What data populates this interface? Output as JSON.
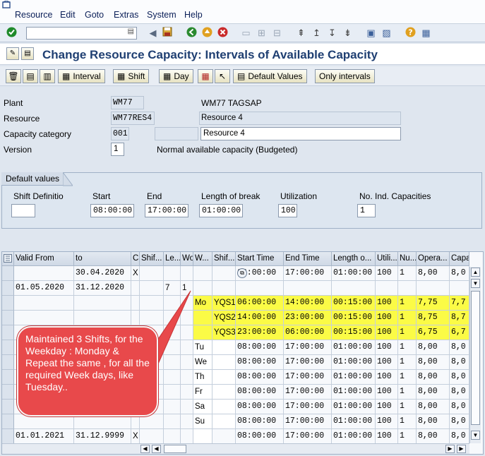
{
  "menu": {
    "items": [
      "Resource",
      "Edit",
      "Goto",
      "Extras",
      "System",
      "Help"
    ]
  },
  "title": "Change Resource Capacity: Intervals of Available Capacity",
  "toolbar": {
    "buttons": {
      "interval": "Interval",
      "shift": "Shift",
      "day": "Day",
      "default_values": "Default Values",
      "only_intervals": "Only intervals"
    }
  },
  "header": {
    "plant_label": "Plant",
    "plant_value": "WM77",
    "plant_desc": "WM77 TAGSAP",
    "resource_label": "Resource",
    "resource_value": "WM77RES4",
    "resource_desc": "Resource 4",
    "capcat_label": "Capacity category",
    "capcat_value": "001",
    "capcat_desc": "Resource 4",
    "version_label": "Version",
    "version_value": "1",
    "version_desc": "Normal available capacity (Budgeted)"
  },
  "defaults": {
    "group_title": "Default values",
    "shift_def_label": "Shift Definitio",
    "shift_def_value": "",
    "start_label": "Start",
    "start_value": "08:00:00",
    "end_label": "End",
    "end_value": "17:00:00",
    "break_label": "Length of break",
    "break_value": "01:00:00",
    "util_label": "Utilization",
    "util_value": "100",
    "indcap_label": "No. Ind. Capacities",
    "indcap_value": "1"
  },
  "table": {
    "columns": [
      "Valid From",
      "to",
      "C",
      "Shif...",
      "Le...",
      "Wo",
      "W...",
      "Shif...",
      "Start Time",
      "End Time",
      "Length o...",
      "Utili...",
      "Nu...",
      "Opera...",
      "Capa"
    ],
    "rows": [
      [
        "",
        "30.04.2020",
        "X",
        "",
        "",
        "",
        "",
        "",
        "08:00:00",
        "17:00:00",
        "01:00:00",
        "100",
        "1",
        "8,00",
        "8,0"
      ],
      [
        "01.05.2020",
        "31.12.2020",
        "",
        "",
        "7",
        "1",
        "",
        "",
        "",
        "",
        "",
        "",
        "",
        "",
        ""
      ],
      [
        "",
        "",
        "",
        "",
        "",
        "",
        "Mo",
        "YQS1",
        "06:00:00",
        "14:00:00",
        "00:15:00",
        "100",
        "1",
        "7,75",
        "7,7"
      ],
      [
        "",
        "",
        "",
        "",
        "",
        "",
        "",
        "YQS2",
        "14:00:00",
        "23:00:00",
        "00:15:00",
        "100",
        "1",
        "8,75",
        "8,7"
      ],
      [
        "",
        "",
        "",
        "",
        "",
        "",
        "",
        "YQS3",
        "23:00:00",
        "06:00:00",
        "00:15:00",
        "100",
        "1",
        "6,75",
        "6,7"
      ],
      [
        "",
        "",
        "",
        "",
        "",
        "",
        "Tu",
        "",
        "08:00:00",
        "17:00:00",
        "01:00:00",
        "100",
        "1",
        "8,00",
        "8,0"
      ],
      [
        "",
        "",
        "",
        "",
        "",
        "",
        "We",
        "",
        "08:00:00",
        "17:00:00",
        "01:00:00",
        "100",
        "1",
        "8,00",
        "8,0"
      ],
      [
        "",
        "",
        "",
        "",
        "",
        "",
        "Th",
        "",
        "08:00:00",
        "17:00:00",
        "01:00:00",
        "100",
        "1",
        "8,00",
        "8,0"
      ],
      [
        "",
        "",
        "",
        "",
        "",
        "",
        "Fr",
        "",
        "08:00:00",
        "17:00:00",
        "01:00:00",
        "100",
        "1",
        "8,00",
        "8,0"
      ],
      [
        "",
        "",
        "",
        "",
        "",
        "",
        "Sa",
        "",
        "08:00:00",
        "17:00:00",
        "01:00:00",
        "100",
        "1",
        "8,00",
        "8,0"
      ],
      [
        "",
        "",
        "",
        "",
        "",
        "",
        "Su",
        "",
        "08:00:00",
        "17:00:00",
        "01:00:00",
        "100",
        "1",
        "8,00",
        "8,0"
      ],
      [
        "01.01.2021",
        "31.12.9999",
        "X",
        "",
        "",
        "",
        "",
        "",
        "08:00:00",
        "17:00:00",
        "01:00:00",
        "100",
        "1",
        "8,00",
        "8,0"
      ]
    ]
  },
  "callout": {
    "text": "Maintained 3 Shifts, for the Weekday : Monday & Repeat the same , for all the required Week days, like Tuesday.."
  },
  "colors": {
    "highlight": "#fbfb46",
    "callout": "#e8494b",
    "title": "#1f3f72"
  }
}
